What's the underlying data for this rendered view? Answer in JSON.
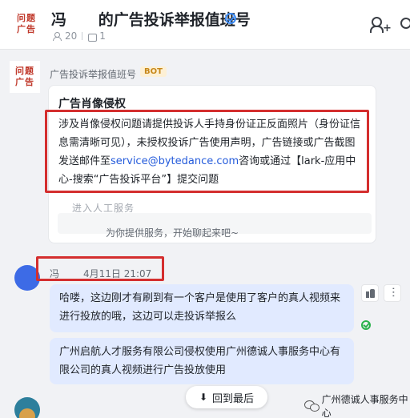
{
  "header": {
    "logo_text_top": "问题",
    "logo_text_bottom": "广告",
    "title": "冯      的广告投诉举报值班号",
    "member_count": "20",
    "bot_count": "1"
  },
  "bot_message": {
    "avatar_top": "问题",
    "avatar_bottom": "广告",
    "sender": "广告投诉举报值班号",
    "badge": "BOT",
    "card_title": "广告肖像侵权",
    "body_part1": "涉及肖像侵权问题请提供投诉人手持身份证正反面照片（身份证信息需清晰可见），未授权投诉广告使用声明，广告链接或广告截图发送邮件至",
    "email": "service@bytedance.com",
    "body_part2": "咨询或通过【lark-应用中心-搜索“广告投诉平台”】提交问题",
    "human_service_label": "进入人工服务",
    "welcome_text": "为你提供服务，开始聊起来吧~"
  },
  "user_message": {
    "sender": "冯",
    "timestamp": "4月11日 21:07",
    "bubble1": "哈喽，这边刚才有刷到有一个客户是使用了客户的真人视频来进行投放的哦，这边可以走投诉举报么",
    "bubble2": "广州启航人才服务有限公司侵权使用广州德诚人事服务中心有限公司的真人视频进行广告投放使用"
  },
  "footer": {
    "back_to_latest": "回到最后",
    "watermark": "广州德诚人事服务中心"
  },
  "colors": {
    "accent_blue": "#245bdb",
    "bubble_blue": "#e1eaff",
    "highlight_red": "#d42e2e",
    "bot_badge_bg": "#fdf0d5"
  },
  "icons": [
    "verified-icon",
    "people-icon",
    "robot-icon",
    "add-member-icon",
    "thumbs-up-icon",
    "more-icon",
    "read-check-icon",
    "arrow-down-icon"
  ]
}
